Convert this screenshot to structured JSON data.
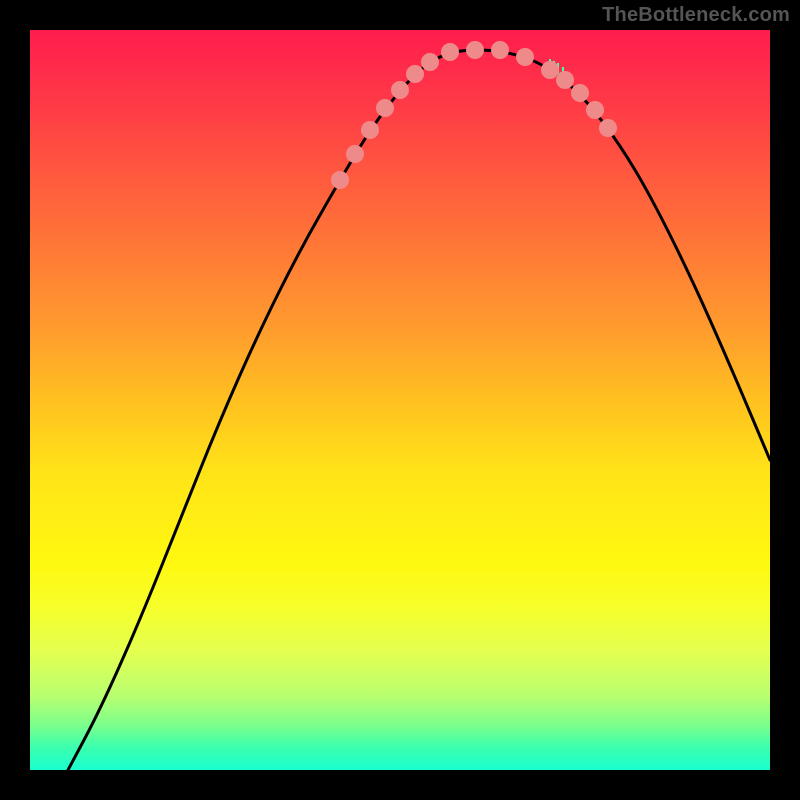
{
  "watermark": "TheBottleneck.com",
  "chart_data": {
    "type": "line",
    "title": "",
    "xlabel": "",
    "ylabel": "",
    "xlim": [
      0,
      740
    ],
    "ylim": [
      0,
      740
    ],
    "grid": false,
    "legend": false,
    "series": [
      {
        "name": "curve",
        "stroke": "#000000",
        "stroke_width": 3,
        "x": [
          38,
          70,
          110,
          150,
          190,
          230,
          270,
          310,
          340,
          370,
          395,
          415,
          435,
          460,
          485,
          510,
          535,
          560,
          590,
          620,
          660,
          700,
          740
        ],
        "y": [
          0,
          60,
          150,
          250,
          350,
          440,
          520,
          590,
          640,
          680,
          705,
          716,
          720,
          720,
          716,
          707,
          690,
          665,
          625,
          575,
          495,
          405,
          310
        ]
      }
    ],
    "markers": {
      "color": "#ef8a8a",
      "radius": 9,
      "points": [
        {
          "x": 310,
          "y": 590
        },
        {
          "x": 325,
          "y": 616
        },
        {
          "x": 340,
          "y": 640
        },
        {
          "x": 355,
          "y": 662
        },
        {
          "x": 370,
          "y": 680
        },
        {
          "x": 385,
          "y": 696
        },
        {
          "x": 400,
          "y": 708
        },
        {
          "x": 420,
          "y": 718
        },
        {
          "x": 445,
          "y": 720
        },
        {
          "x": 470,
          "y": 720
        },
        {
          "x": 495,
          "y": 713
        },
        {
          "x": 520,
          "y": 700
        },
        {
          "x": 535,
          "y": 690
        },
        {
          "x": 550,
          "y": 677
        },
        {
          "x": 565,
          "y": 660
        },
        {
          "x": 578,
          "y": 642
        }
      ]
    },
    "highlight_ticks": {
      "color": "#41ffb8",
      "segments": [
        {
          "x": 520,
          "y1": 700,
          "y2": 711
        },
        {
          "x": 524,
          "y1": 697,
          "y2": 709
        },
        {
          "x": 528,
          "y1": 694,
          "y2": 707
        },
        {
          "x": 533,
          "y1": 692,
          "y2": 703
        }
      ]
    }
  }
}
